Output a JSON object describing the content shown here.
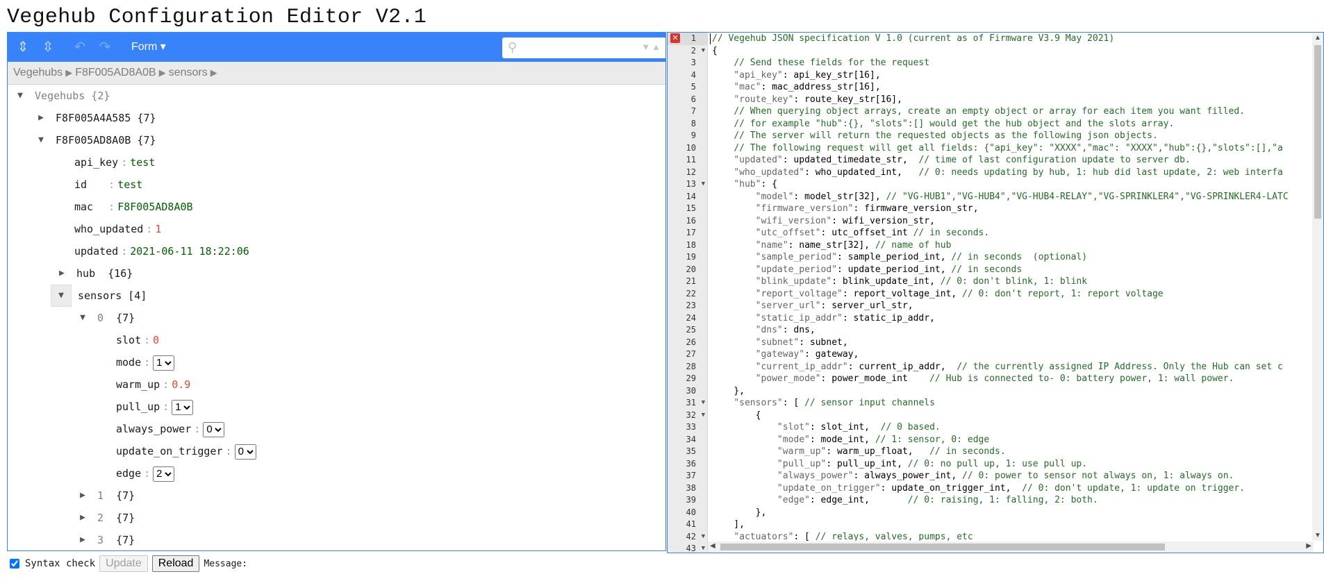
{
  "page_title": "Vegehub Configuration Editor V2.1",
  "tree_editor": {
    "menu": {
      "expand_all_icon": "expand-all-icon",
      "collapse_all_icon": "collapse-all-icon",
      "mode_label": "Form ▾",
      "search_placeholder": ""
    },
    "breadcrumb": [
      "Vegehubs",
      "F8F005AD8A0B",
      "sensors"
    ],
    "nodes": {
      "root": {
        "name": "Vegehubs",
        "meta": "{2}"
      },
      "hub_a": {
        "name": "F8F005A4A585",
        "meta": "{7}"
      },
      "hub_b": {
        "name": "F8F005AD8A0B",
        "meta": "{7}"
      },
      "api_key": {
        "name": "api_key",
        "value": "test"
      },
      "id": {
        "name": "id",
        "value": "test"
      },
      "mac": {
        "name": "mac",
        "value": "F8F005AD8A0B"
      },
      "who_updated": {
        "name": "who_updated",
        "value": "1"
      },
      "updated": {
        "name": "updated",
        "value": "2021-06-11 18:22:06"
      },
      "hub": {
        "name": "hub",
        "meta": "{16}"
      },
      "sensors": {
        "name": "sensors",
        "meta": "[4]"
      },
      "s0": {
        "name": "0",
        "meta": "{7}"
      },
      "slot": {
        "name": "slot",
        "value": "0"
      },
      "mode": {
        "name": "mode",
        "value": "1"
      },
      "warm_up": {
        "name": "warm_up",
        "value": "0.9"
      },
      "pull_up": {
        "name": "pull_up",
        "value": "1"
      },
      "always_power": {
        "name": "always_power",
        "value": "0"
      },
      "update_on_trigger": {
        "name": "update_on_trigger",
        "value": "0"
      },
      "edge": {
        "name": "edge",
        "value": "2"
      },
      "s1": {
        "name": "1",
        "meta": "{7}"
      },
      "s2": {
        "name": "2",
        "meta": "{7}"
      },
      "s3": {
        "name": "3",
        "meta": "{7}"
      }
    }
  },
  "code_editor": {
    "lines": [
      "// Vegehub JSON specification V 1.0 (current as of Firmware V3.9 May 2021)",
      "{",
      "    // Send these fields for the request",
      "    \"api_key\": api_key_str[16],",
      "    \"mac\": mac_address_str[16],",
      "    \"route_key\": route_key_str[16],",
      "    // When querying object arrays, create an empty object or array for each item you want filled.",
      "    // for example \"hub\":{}, \"slots\":[] would get the hub object and the slots array.",
      "    // The server will return the requested objects as the following json objects.",
      "    // The following request will get all fields: {\"api_key\": \"XXXX\",\"mac\": \"XXXX\",\"hub\":{},\"slots\":[],\"a",
      "    \"updated\": updated_timedate_str,  // time of last configuration update to server db.",
      "    \"who_updated\": who_updated_int,   // 0: needs updating by hub, 1: hub did last update, 2: web interfa",
      "    \"hub\": {",
      "        \"model\": model_str[32], // \"VG-HUB1\",\"VG-HUB4\",\"VG-HUB4-RELAY\",\"VG-SPRINKLER4\",\"VG-SPRINKLER4-LATC",
      "        \"firmware_version\": firmware_version_str,",
      "        \"wifi_version\": wifi_version_str,",
      "        \"utc_offset\": utc_offset_int // in seconds.",
      "        \"name\": name_str[32], // name of hub",
      "        \"sample_period\": sample_period_int, // in seconds  (optional)",
      "        \"update_period\": update_period_int, // in seconds",
      "        \"blink_update\": blink_update_int, // 0: don't blink, 1: blink",
      "        \"report_voltage\": report_voltage_int, // 0: don't report, 1: report voltage",
      "        \"server_url\": server_url_str,",
      "        \"static_ip_addr\": static_ip_addr,",
      "        \"dns\": dns,",
      "        \"subnet\": subnet,",
      "        \"gateway\": gateway,",
      "        \"current_ip_addr\": current_ip_addr,  // the currently assigned IP Address. Only the Hub can set c",
      "        \"power_mode\": power_mode_int    // Hub is connected to- 0: battery power, 1: wall power.",
      "    },",
      "    \"sensors\": [ // sensor input channels",
      "        {",
      "            \"slot\": slot_int,  // 0 based.",
      "            \"mode\": mode_int, // 1: sensor, 0: edge",
      "            \"warm_up\": warm_up_float,   // in seconds.",
      "            \"pull_up\": pull_up_int, // 0: no pull up, 1: use pull up.",
      "            \"always_power\": always_power_int, // 0: power to sensor not always on, 1: always on.",
      "            \"update_on_trigger\": update_on_trigger_int,  // 0: don't update, 1: update on trigger.",
      "            \"edge\": edge_int,       // 0: raising, 1: falling, 2: both.",
      "        },",
      "    ],",
      "    \"actuators\": [ // relays, valves, pumps, etc",
      ""
    ],
    "folds": [
      2,
      13,
      31,
      32,
      42,
      43
    ]
  },
  "footer": {
    "syntax_check_label": "Syntax check",
    "update_label": "Update",
    "reload_label": "Reload",
    "message_label": "Message:"
  }
}
